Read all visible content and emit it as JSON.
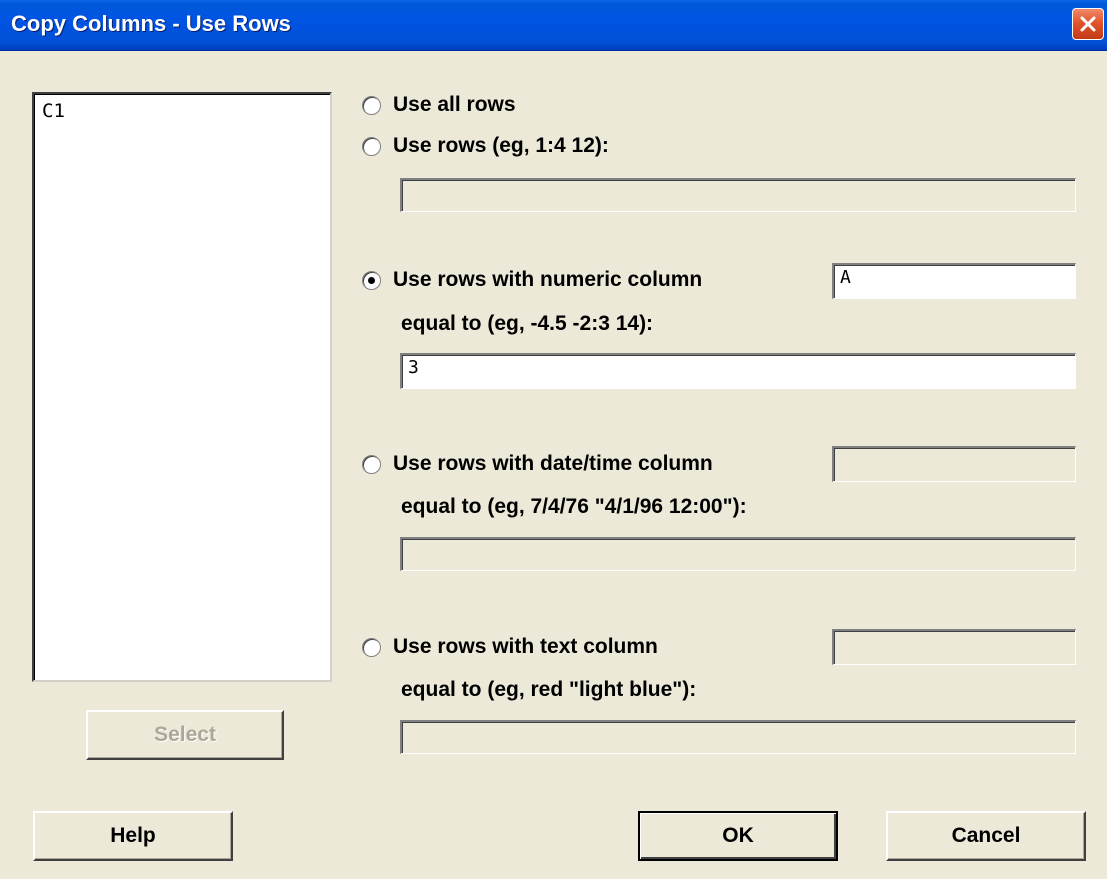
{
  "window": {
    "title": "Copy Columns - Use Rows",
    "close_icon": "close-icon"
  },
  "columns_list": {
    "items": [
      "C1"
    ]
  },
  "buttons": {
    "select": "Select",
    "help": "Help",
    "ok": "OK",
    "cancel": "Cancel"
  },
  "options": {
    "use_all_rows": {
      "label": "Use all rows",
      "checked": false
    },
    "use_rows": {
      "label": "Use rows (eg,  1:4  12):",
      "value": "",
      "checked": false
    },
    "numeric": {
      "label": "Use rows with numeric column",
      "column_value": "A",
      "equal_label": "equal to (eg,  -4.5  -2:3  14):",
      "equal_value": "3",
      "checked": true
    },
    "datetime": {
      "label": "Use rows with date/time column",
      "column_value": "",
      "equal_label": "equal to (eg,  7/4/76  \"4/1/96 12:00\"):",
      "equal_value": "",
      "checked": false
    },
    "text": {
      "label": "Use rows with text column",
      "column_value": "",
      "equal_label": "equal to (eg,  red  \"light blue\"):",
      "equal_value": "",
      "checked": false
    }
  },
  "colors": {
    "titlebar": "#0054e3",
    "dialog_bg": "#ece9d8",
    "close_button": "#e2552c"
  }
}
